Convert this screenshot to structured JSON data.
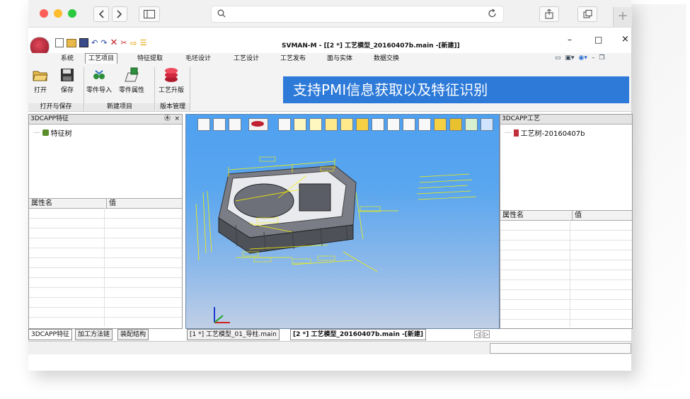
{
  "browser": {
    "back_icon": "chevron-left",
    "forward_icon": "chevron-right",
    "sidebar_icon": "sidebar-icon",
    "search_icon": "search-icon",
    "reload_icon": "reload-icon",
    "share_icon": "share-icon",
    "tabs_icon": "tabs-icon",
    "new_tab_symbol": "+"
  },
  "app": {
    "title": "SVMAN-M - [[2 *] 工艺模型_20160407b.main -[新建]]",
    "win_min": "–",
    "win_max": "□",
    "win_close": "×"
  },
  "menubar": [
    "系统",
    "工艺项目",
    "特征提取",
    "毛坯设计",
    "工艺设计",
    "工艺发布",
    "面与实体",
    "数据交换"
  ],
  "ribbon": {
    "buttons": [
      {
        "label": "打开"
      },
      {
        "label": "保存"
      },
      {
        "label": "零件导入"
      },
      {
        "label": "零件属性"
      },
      {
        "label": "工艺升版"
      }
    ],
    "groups": [
      "打开与保存",
      "新建项目",
      "版本管理"
    ]
  },
  "banner": "支持PMI信息获取以及特征识别",
  "left_panel": {
    "title": "3DCAPP特征",
    "pin": "㊍",
    "close": "×",
    "tree_root": "特征树",
    "prop_headers": [
      "属性名",
      "值"
    ],
    "bottom_tabs": [
      "3DCAPP特征",
      "加工方法链",
      "装配结构"
    ]
  },
  "right_panel": {
    "title": "3DCAPP工艺",
    "tree_root": "工艺树-20160407b",
    "prop_headers": [
      "属性名",
      "值"
    ]
  },
  "doc_tabs": [
    "[1 *] 工艺模型_01_导柱.main",
    "[2 *] 工艺模型_20160407b.main -[新建]"
  ],
  "doc_tab_nav": [
    "◁",
    "▷"
  ],
  "colors": {
    "banner_bg": "#2d7ad9",
    "viewport_top": "#4ea0f0",
    "viewport_bottom": "#c0cfe6",
    "dim_lines": "#f5f200",
    "model_gray": "#6e7179"
  }
}
